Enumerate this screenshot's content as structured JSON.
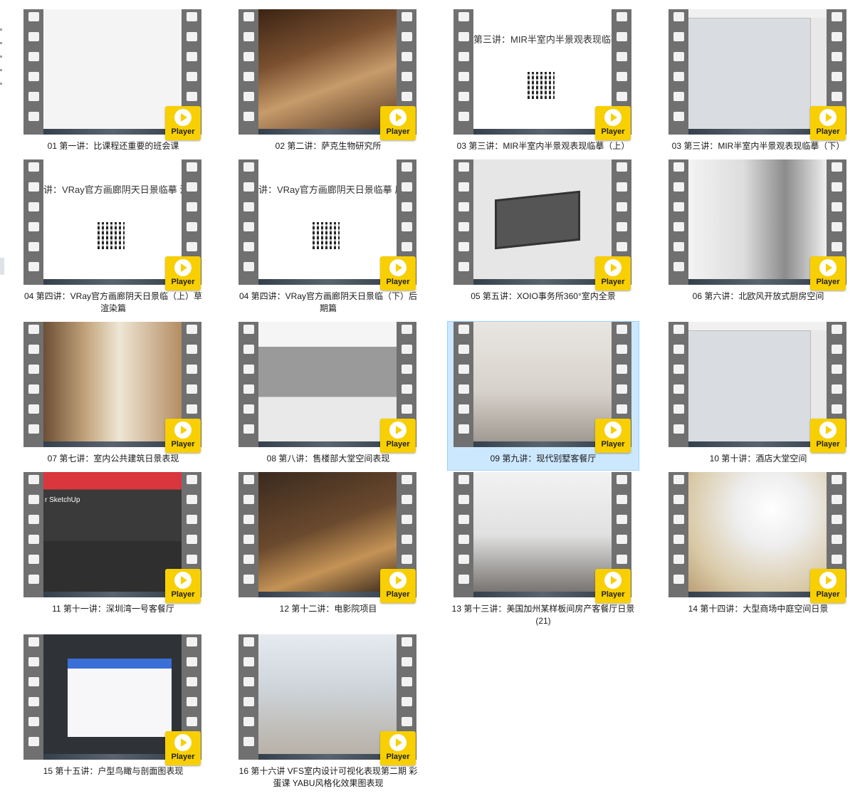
{
  "player_label": "Player",
  "selected_index": 10,
  "videos": [
    {
      "label": "01 第一讲：比课程还重要的班会课",
      "scene": "t-white"
    },
    {
      "label": "02 第二讲：萨克生物研究所",
      "scene": "t-wood"
    },
    {
      "label": "03 第三讲：MIR半室内半景观表现临摹（上）",
      "scene": "t-slide",
      "slide_title": "第三讲：MIR半室内半景观表现临摹"
    },
    {
      "label": "03 第三讲：MIR半室内半景观表现临摹（下）",
      "scene": "t-sketch"
    },
    {
      "label": "04 第四讲：VRay官方画廊阴天日景临（上）草渲染篇",
      "scene": "t-slide",
      "slide_title": "讲：VRay官方画廊阴天日景临摹 渲染篇"
    },
    {
      "label": "04 第四讲：VRay官方画廊阴天日景临（下）后期篇",
      "scene": "t-slide",
      "slide_title": "讲：VRay官方画廊阴天日景临摹 后期篇"
    },
    {
      "label": "05 第五讲：XOIO事务所360°室内全景",
      "scene": "t-box"
    },
    {
      "label": "06 第六讲：北欧风开放式厨房空间",
      "scene": "t-kitchen"
    },
    {
      "label": "07 第七讲：室内公共建筑日景表现",
      "scene": "t-corridor"
    },
    {
      "label": "08 第八讲：售楼部大堂空间表现",
      "scene": "t-build"
    },
    {
      "label": "09 第九讲：现代别墅客餐厅",
      "scene": "t-room"
    },
    {
      "label": "10 第十讲：酒店大堂空间",
      "scene": "t-sketch"
    },
    {
      "label": "11 第十一讲：深圳湾一号客餐厅",
      "scene": "t-web",
      "web_text": "r SketchUp"
    },
    {
      "label": "12 第十二讲：电影院项目",
      "scene": "t-cinema"
    },
    {
      "label": "13 第十三讲：美国加州某样板间房产客餐厅日景(21)",
      "scene": "t-dining"
    },
    {
      "label": "14 第十四讲：大型商场中庭空间日景",
      "scene": "t-mall"
    },
    {
      "label": "15 第十五讲：户型鸟瞰与剖面图表现",
      "scene": "t-app"
    },
    {
      "label": "16 第十六讲 VFS室内设计可视化表现第二期 彩蛋课 YABU风格化效果图表现",
      "scene": "t-lobby"
    }
  ]
}
